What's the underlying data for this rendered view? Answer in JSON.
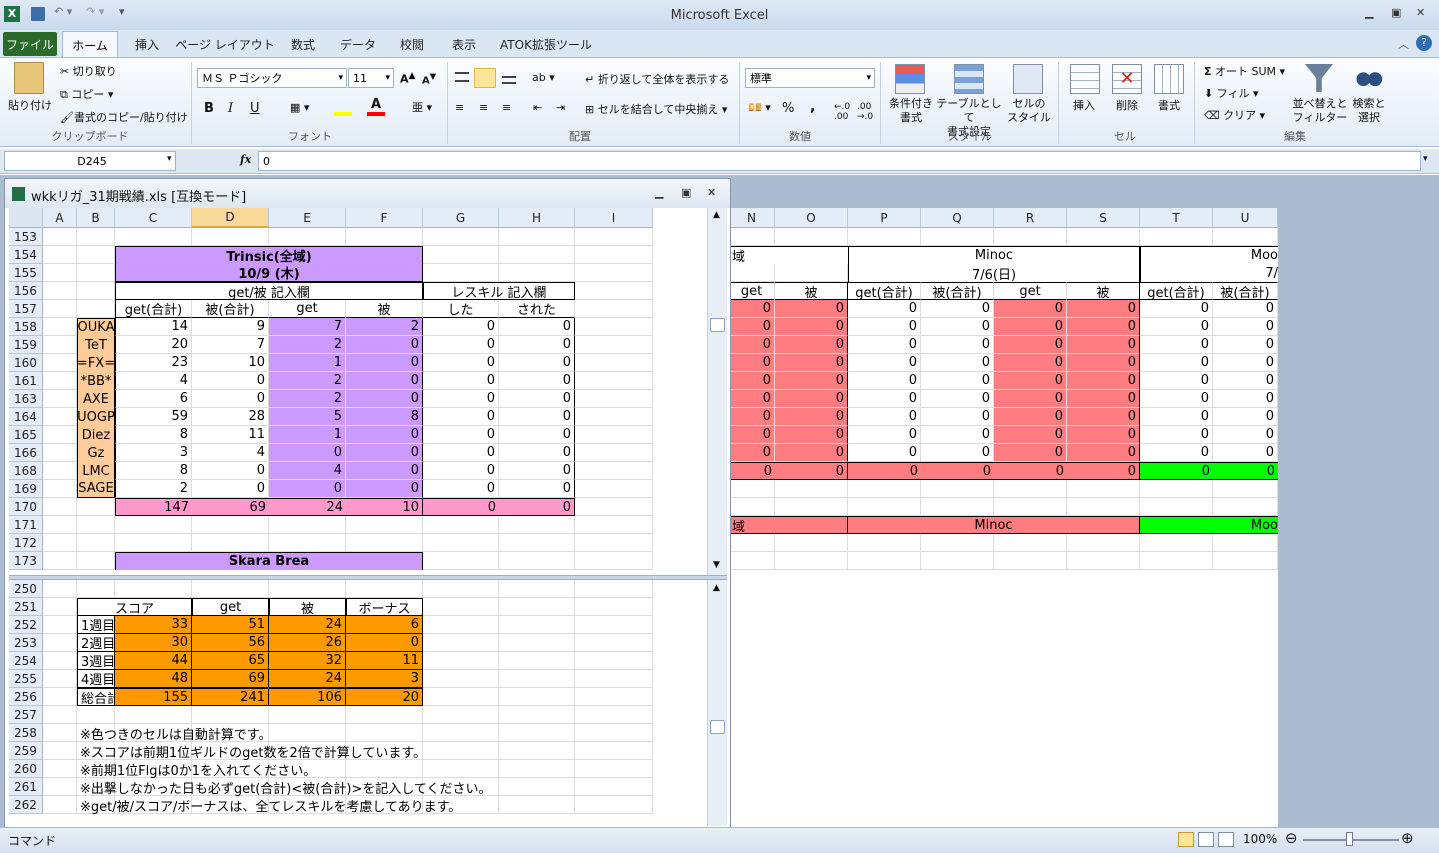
{
  "app": {
    "title": "Microsoft Excel"
  },
  "tabs": [
    "ファイル",
    "ホーム",
    "挿入",
    "ページ レイアウト",
    "数式",
    "データ",
    "校閲",
    "表示",
    "ATOK拡張ツール"
  ],
  "ribbon": {
    "clipboard": {
      "paste": "貼り付け",
      "cut": "切り取り",
      "copy": "コピー",
      "format_painter": "書式のコピー/貼り付け",
      "group": "クリップボード"
    },
    "font": {
      "name": "ＭＳ Ｐゴシック",
      "size": "11",
      "bold": "B",
      "italic": "I",
      "underline": "U",
      "group": "フォント"
    },
    "alignment": {
      "wrap": "折り返して全体を表示する",
      "merge": "セルを結合して中央揃え",
      "group": "配置"
    },
    "number": {
      "format": "標準",
      "percent": "%",
      "comma": ",",
      "group": "数値"
    },
    "styles": {
      "conditional": "条件付き\n書式",
      "table": "テーブルとして\n書式設定",
      "cell_style": "セルの\nスタイル",
      "group": "スタイル"
    },
    "cells": {
      "insert": "挿入",
      "delete": "削除",
      "format": "書式",
      "group": "セル"
    },
    "editing": {
      "autosum": "オート SUM",
      "fill": "フィル",
      "clear": "クリア",
      "sort": "並べ替えと\nフィルター",
      "find": "検索と\n選択",
      "group": "編集"
    }
  },
  "formula_bar": {
    "name_box": "D245",
    "fx": "fx",
    "value": "0"
  },
  "workbook": {
    "title": "wkkリガ_31期戦績.xls  [互換モード]"
  },
  "columns": [
    "A",
    "B",
    "C",
    "D",
    "E",
    "F",
    "G",
    "H",
    "I"
  ],
  "right_columns": [
    "N",
    "O",
    "P",
    "Q",
    "R",
    "S",
    "T",
    "U"
  ],
  "top_rows": [
    "153",
    "154",
    "155",
    "156",
    "157",
    "158",
    "159",
    "160",
    "161",
    "163",
    "164",
    "165",
    "166",
    "168",
    "169",
    "170",
    "171",
    "172",
    "173"
  ],
  "bottom_rows": [
    "250",
    "251",
    "252",
    "253",
    "254",
    "255",
    "256",
    "257",
    "258",
    "259",
    "260",
    "261",
    "262"
  ],
  "trinsic": {
    "title": "Trinsic(全域)",
    "date": "10/9 (木)",
    "entry_header": "get/被  記入欄",
    "res_header": "レスキル  記入欄",
    "sub": [
      "get(合計)",
      "被(合計)",
      "get",
      "被",
      "した",
      "された"
    ]
  },
  "guilds": [
    {
      "name": "OUKA",
      "v": [
        "14",
        "9",
        "7",
        "2",
        "0",
        "0"
      ]
    },
    {
      "name": "TeT",
      "v": [
        "20",
        "7",
        "2",
        "0",
        "0",
        "0"
      ]
    },
    {
      "name": "=FX=",
      "v": [
        "23",
        "10",
        "1",
        "0",
        "0",
        "0"
      ]
    },
    {
      "name": "*BB*",
      "v": [
        "4",
        "0",
        "2",
        "0",
        "0",
        "0"
      ]
    },
    {
      "name": "AXE",
      "v": [
        "6",
        "0",
        "2",
        "0",
        "0",
        "0"
      ]
    },
    {
      "name": "UOGP",
      "v": [
        "59",
        "28",
        "5",
        "8",
        "0",
        "0"
      ]
    },
    {
      "name": "Diez",
      "v": [
        "8",
        "11",
        "1",
        "0",
        "0",
        "0"
      ]
    },
    {
      "name": "Gz",
      "v": [
        "3",
        "4",
        "0",
        "0",
        "0",
        "0"
      ]
    },
    {
      "name": "LMC",
      "v": [
        "8",
        "0",
        "4",
        "0",
        "0",
        "0"
      ]
    },
    {
      "name": "SAGE",
      "v": [
        "2",
        "0",
        "0",
        "0",
        "0",
        "0"
      ]
    }
  ],
  "totals": [
    "147",
    "69",
    "24",
    "10",
    "0",
    "0"
  ],
  "skara": "Skara Brea",
  "score": {
    "headers": [
      "スコア",
      "get",
      "被",
      "ボーナス"
    ],
    "rows": [
      {
        "label": "1週目",
        "v": [
          "33",
          "51",
          "24",
          "6"
        ]
      },
      {
        "label": "2週目",
        "v": [
          "30",
          "56",
          "26",
          "0"
        ]
      },
      {
        "label": "3週目",
        "v": [
          "44",
          "65",
          "32",
          "11"
        ]
      },
      {
        "label": "4週目",
        "v": [
          "48",
          "69",
          "24",
          "3"
        ]
      },
      {
        "label": "総合計",
        "v": [
          "155",
          "241",
          "106",
          "20"
        ]
      }
    ]
  },
  "notes": [
    "※色つきのセルは自動計算です。",
    "※スコアは前期1位ギルドのget数を2倍で計算しています。",
    "※前期1位Flgは0か1を入れてください。",
    "※出撃しなかった日も必ずget(合計)<被(合計)>を記入してください。",
    "※get/被/スコア/ボーナスは、全てレスキルを考慮してあります。"
  ],
  "right": {
    "n_frag": "域",
    "minoc": "Minoc",
    "minoc_date": "7/6(日)",
    "moo": "Moo",
    "moo_date": "7/",
    "sub": [
      "get",
      "被",
      "get(合計)",
      "被(合計)",
      "get",
      "被",
      "get(合計)",
      "被(合計)"
    ],
    "zero": "0",
    "minoc_bottom": "Minoc",
    "moo_bottom": "Moo"
  },
  "status": {
    "mode": "コマンド",
    "zoom": "100%"
  },
  "colors": {
    "purple": "#cc99ff",
    "orange_light": "#ffcc99",
    "pink": "#ff99cc",
    "orange": "#ff9900",
    "red": "#ff7c80",
    "green": "#00ff00",
    "excel_green": "#2a6b2a"
  }
}
